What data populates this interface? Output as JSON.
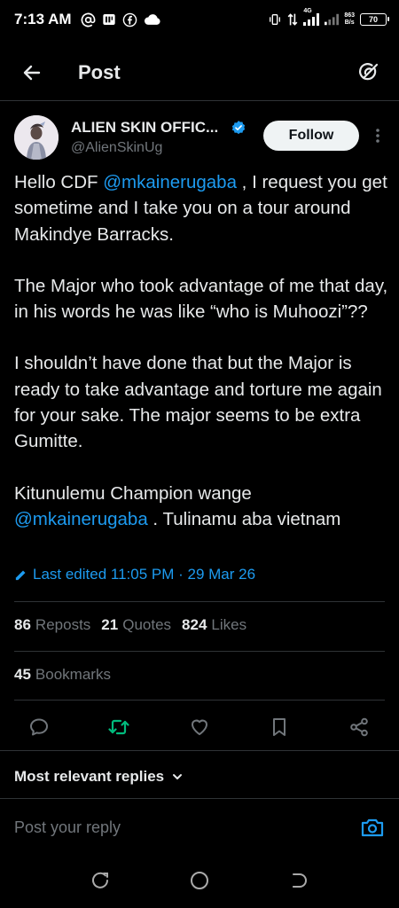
{
  "status_bar": {
    "time": "7:13 AM",
    "net_speed_value": "863",
    "net_speed_unit": "B/s",
    "network_type": "4G",
    "battery": "70"
  },
  "header": {
    "title": "Post",
    "back_icon": "arrow-left-icon",
    "grok_icon": "grok-icon"
  },
  "author": {
    "name": "ALIEN SKIN OFFIC...",
    "handle": "@AlienSkinUg",
    "verified": true,
    "follow_label": "Follow"
  },
  "tweet": {
    "p1_before": "Hello CDF ",
    "p1_mention": "@mkainerugaba",
    "p1_after": " , I request you get sometime and I take you on a tour around Makindye Barracks.",
    "p2": "The Major who took advantage of me that day, in his words he was like “who is Muhoozi”??",
    "p3": "I shouldn’t have done that but the Major is ready to take advantage and torture me again for your sake. The major seems to be extra Gumitte.",
    "p4_before": "Kitunulemu Champion wange ",
    "p4_mention": "@mkainerugaba",
    "p4_after": " . Tulinamu aba vietnam"
  },
  "edited": {
    "label": "Last edited 11:05 PM · 29 Mar 26"
  },
  "stats": {
    "reposts_count": "86",
    "reposts_label": "Reposts",
    "quotes_count": "21",
    "quotes_label": "Quotes",
    "likes_count": "824",
    "likes_label": "Likes",
    "bookmarks_count": "45",
    "bookmarks_label": "Bookmarks"
  },
  "actions": [
    "reply-icon",
    "repost-icon",
    "like-icon",
    "bookmark-icon",
    "share-icon"
  ],
  "colors": {
    "background": "#000000",
    "text": "#e7e9ea",
    "muted": "#71767b",
    "accent": "#1d9bf0",
    "repost_active": "#00ba7c",
    "divider": "#2f3336"
  },
  "replies": {
    "filter_label": "Most relevant replies",
    "reply_placeholder": "Post your reply"
  }
}
